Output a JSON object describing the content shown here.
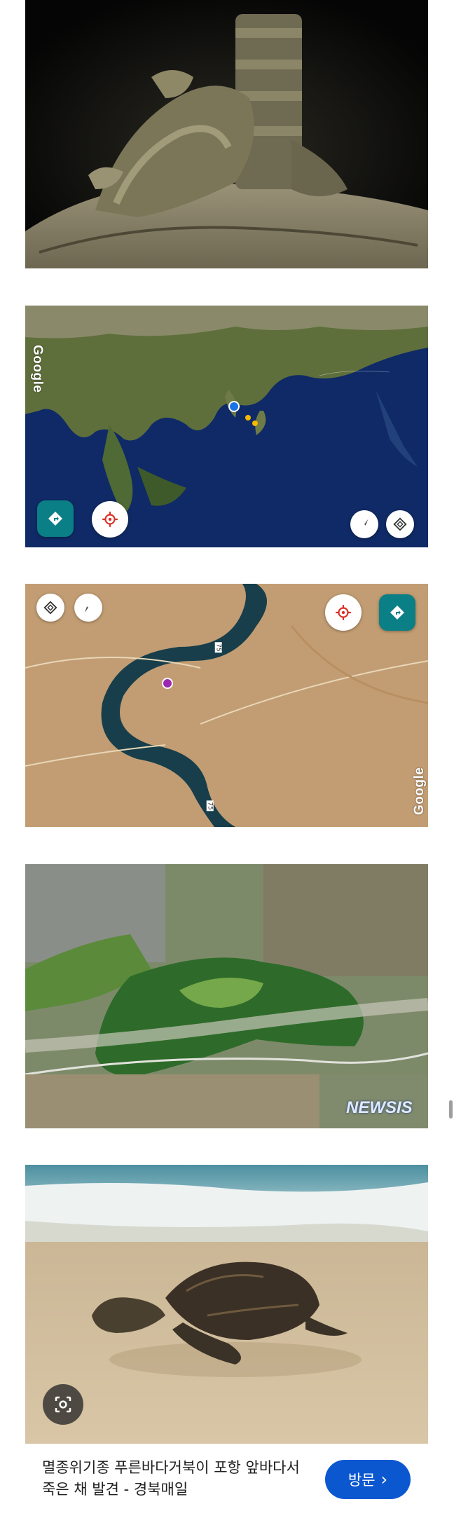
{
  "images": [
    {
      "name": "bronze-incense-burner-photo"
    },
    {
      "name": "asia-pacific-satellite-map"
    },
    {
      "name": "river-canyon-satellite-map"
    },
    {
      "name": "royal-tombs-aerial-photo"
    },
    {
      "name": "sea-turtle-on-beach-photo"
    }
  ],
  "map1": {
    "google_label": "Google",
    "icons": [
      "directions-icon",
      "my-location-icon",
      "compass-icon",
      "layers-icon"
    ]
  },
  "map2": {
    "google_label": "Google",
    "road_label": "75",
    "icons": [
      "layers-icon",
      "compass-icon",
      "my-location-icon",
      "directions-icon",
      "place-pin-icon"
    ]
  },
  "aerial": {
    "watermark": "NEWSIS"
  },
  "result": {
    "caption": "멸종위기종 푸른바다거북이 포항 앞바다서 죽은 채 발견 - 경북매일",
    "visit_label": "방문",
    "visit_chevron": "›"
  },
  "colors": {
    "accent_blue": "#0b57d0",
    "map_teal": "#0b7f86"
  }
}
